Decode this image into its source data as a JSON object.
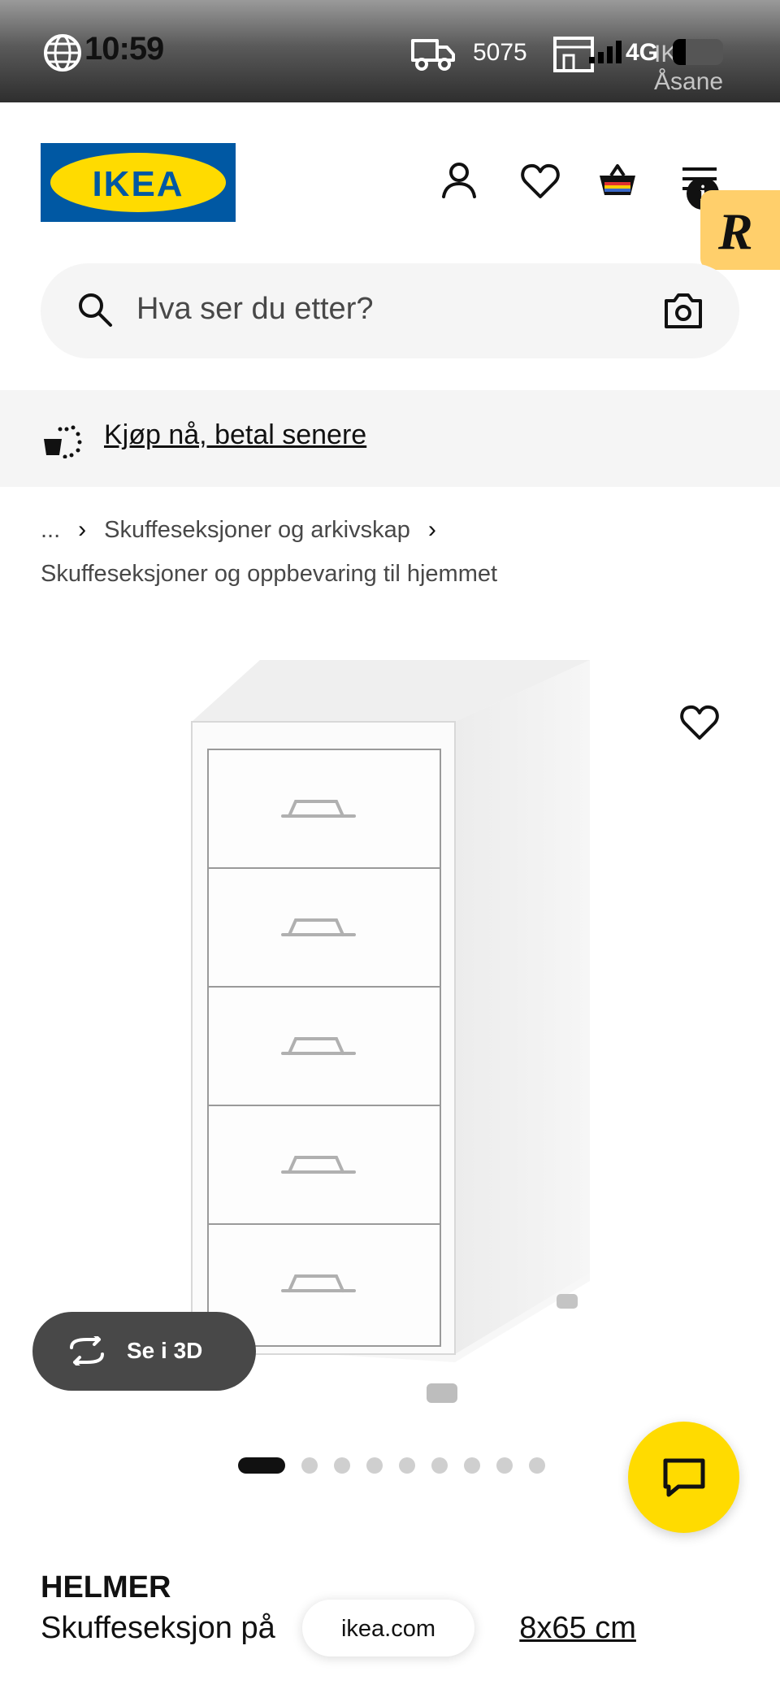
{
  "status_bar": {
    "time": "10:59",
    "delivery_count": "5075",
    "network": "4G",
    "store_name": "IKEA Åsane"
  },
  "header": {
    "logo_text": "IKEA",
    "brand_colors": {
      "blue": "#0058a3",
      "yellow": "#ffdb00"
    },
    "icons": [
      "user-icon",
      "heart-icon",
      "basket-icon",
      "menu-icon"
    ],
    "info_badge": "i",
    "r_badge": "R"
  },
  "search": {
    "placeholder": "Hva ser du etter?"
  },
  "pay_banner": {
    "label": "Kjøp nå, betal senere"
  },
  "breadcrumb": {
    "ellipsis": "...",
    "level1": "Skuffeseksjoner og arkivskap",
    "level2": "Skuffeseksjoner og oppbevaring til hjemmet"
  },
  "gallery": {
    "view_3d_label": "Se i 3D",
    "total_images": 9,
    "active_index": 0
  },
  "product": {
    "name": "HELMER",
    "description_start": "Skuffeseksjon på ",
    "description_end": "8x65 cm"
  },
  "browser": {
    "url": "ikea.com"
  }
}
